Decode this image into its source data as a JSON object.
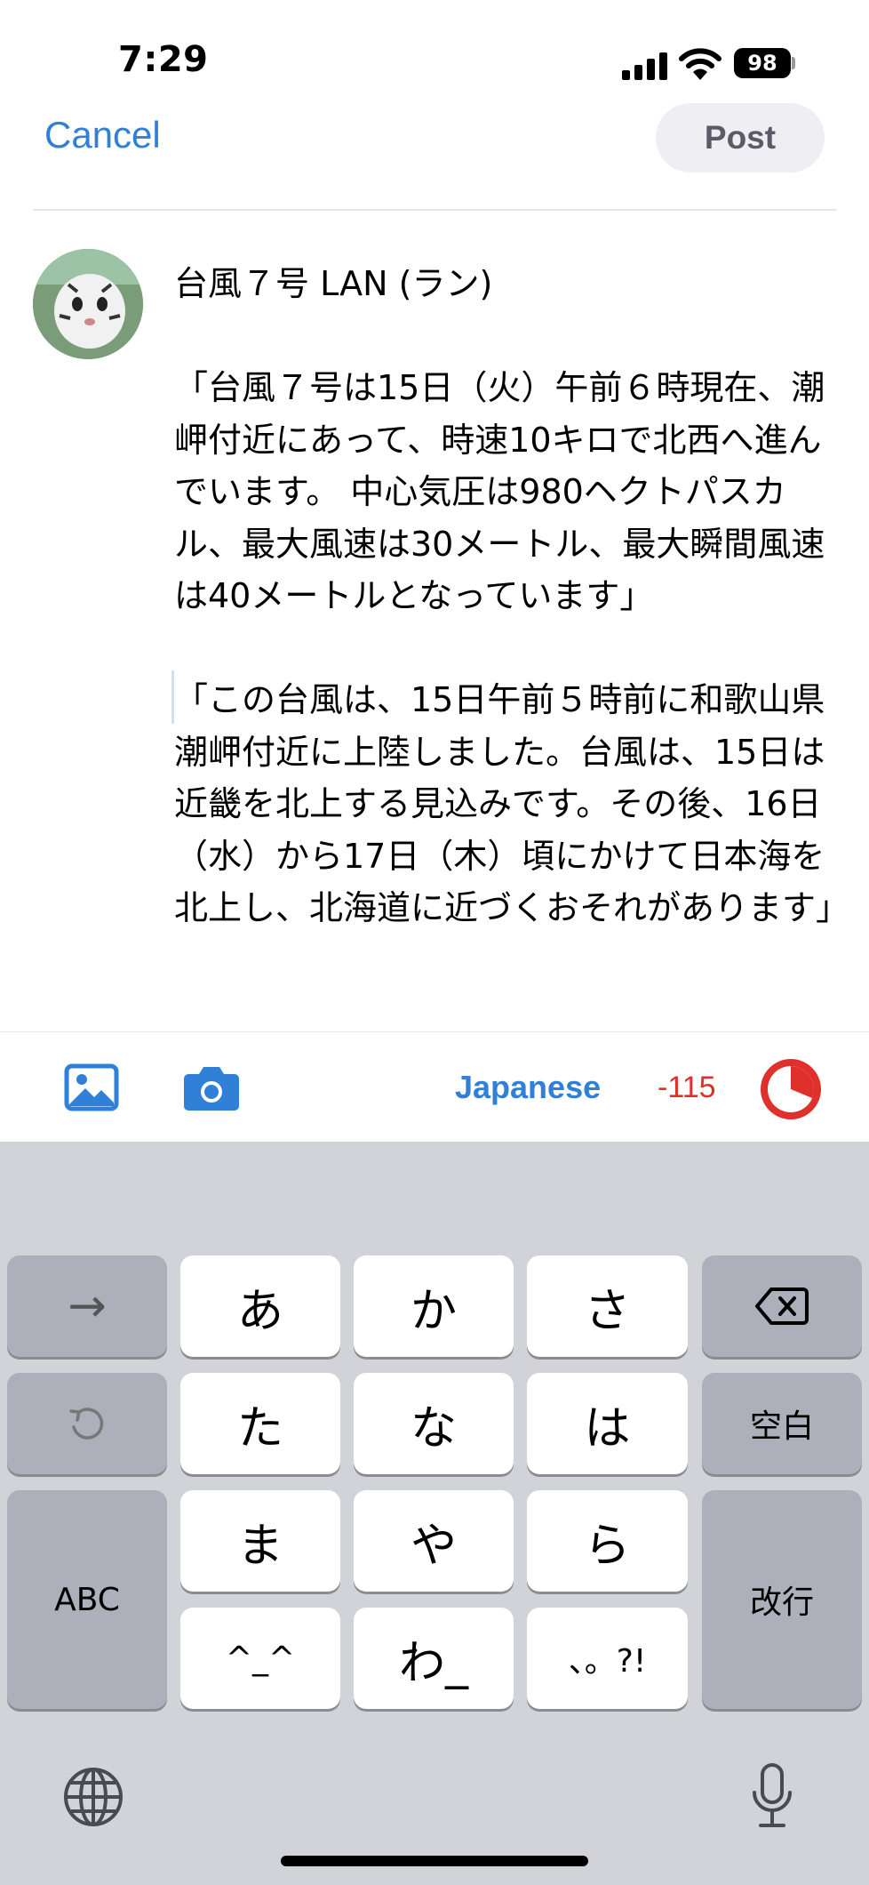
{
  "status_bar": {
    "time": "7:29",
    "battery": "98"
  },
  "header": {
    "cancel_label": "Cancel",
    "post_label": "Post"
  },
  "composer": {
    "text": "台風７号 LAN (ラン)\n\n「台風７号は15日（火）午前６時現在、潮岬付近にあって、時速10キロで北西へ進んでいます。 中心気圧は980ヘクトパスカル、最大風速は30メートル、最大瞬間風速は40メートルとなっています」\n\n「この台風は、15日午前５時前に和歌山県潮岬付近に上陸しました。台風は、15日は近畿を北上する見込みです。その後、16日（水）から17日（木）頃にかけて日本海を北上し、北海道に近づくおそれがあります」"
  },
  "toolbar": {
    "language": "Japanese",
    "char_count": "-115",
    "icons": [
      "photo-library-icon",
      "camera-icon"
    ]
  },
  "keyboard": {
    "keys": {
      "arrow": "→",
      "a": "あ",
      "ka": "か",
      "sa": "さ",
      "ta": "た",
      "na": "な",
      "ha": "は",
      "space": "空白",
      "ma": "ま",
      "ya": "や",
      "ra": "ら",
      "abc": "ABC",
      "return": "改行",
      "emoticon": "^_^",
      "wa": "わ_",
      "punct": "、。?!"
    }
  },
  "colors": {
    "accent": "#2f80d6",
    "warning": "#e0302b",
    "keyboard_bg": "#d2d3d9"
  }
}
